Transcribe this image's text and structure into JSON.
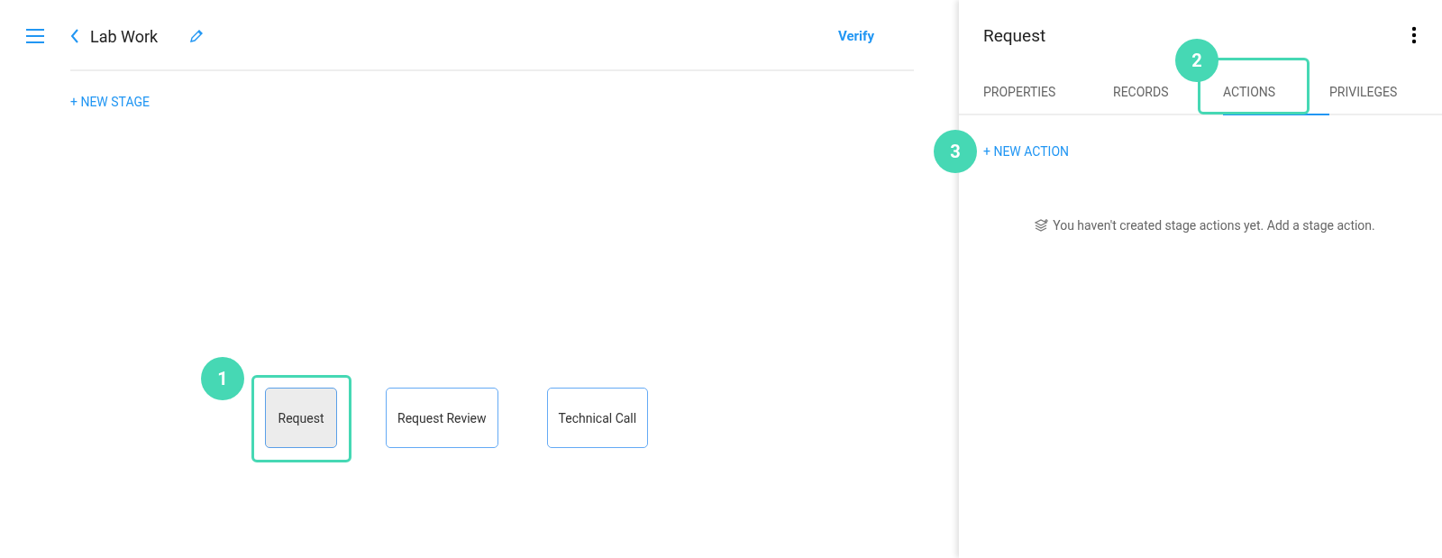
{
  "header": {
    "back_title": "Lab Work",
    "verify": "Verify"
  },
  "new_stage": "+ NEW STAGE",
  "stages": [
    {
      "label": "Request",
      "selected": true,
      "callout": "1"
    },
    {
      "label": "Request Review",
      "selected": false
    },
    {
      "label": "Technical Call",
      "selected": false
    }
  ],
  "panel": {
    "title": "Request",
    "tabs": [
      {
        "label": "PROPERTIES",
        "selected": false
      },
      {
        "label": "RECORDS",
        "selected": false
      },
      {
        "label": "ACTIONS",
        "selected": true,
        "callout": "2"
      },
      {
        "label": "PRIVILEGES",
        "selected": false
      }
    ],
    "new_action": {
      "label": "+ NEW ACTION",
      "callout": "3"
    },
    "empty_message": "You haven't created stage actions yet. Add a stage action."
  }
}
